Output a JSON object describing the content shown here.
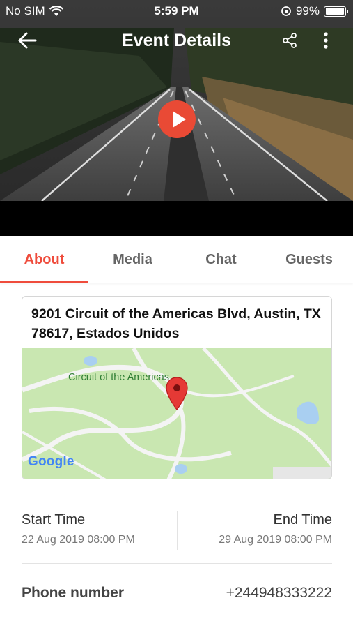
{
  "status_bar": {
    "carrier": "No SIM",
    "time": "5:59 PM",
    "battery": "99%"
  },
  "toolbar": {
    "title": "Event Details"
  },
  "icons": {
    "back": "arrow-left-icon",
    "share": "share-icon",
    "more": "more-vertical-icon",
    "play": "play-icon",
    "map_pin": "map-pin-icon"
  },
  "tabs": [
    {
      "label": "About"
    },
    {
      "label": "Media"
    },
    {
      "label": "Chat"
    },
    {
      "label": "Guests"
    }
  ],
  "location": {
    "address": "9201 Circuit of the Americas Blvd, Austin, TX 78617, Estados Unidos",
    "map_place_label": "Circuit of the Americas",
    "map_brand": "Google"
  },
  "times": {
    "start_label": "Start Time",
    "start_value": "22 Aug 2019 08:00 PM",
    "end_label": "End Time",
    "end_value": "29 Aug 2019 08:00 PM"
  },
  "phone": {
    "label": "Phone number",
    "value": "+244948333222"
  },
  "colors": {
    "accent": "#ef4c3c",
    "play_button": "#e94a35",
    "map_green": "#c9e7b1"
  }
}
